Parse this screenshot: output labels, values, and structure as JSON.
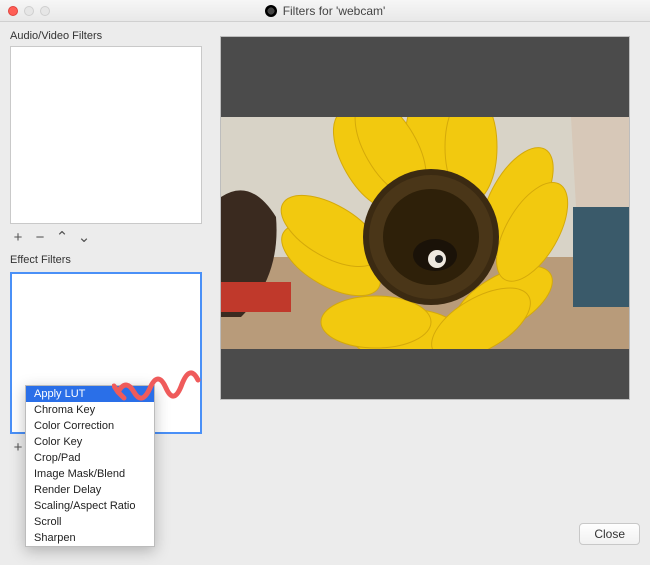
{
  "window": {
    "title": "Filters for 'webcam'"
  },
  "sections": {
    "audio_label": "Audio/Video Filters",
    "effect_label": "Effect Filters"
  },
  "toolbar": {
    "add": "+",
    "remove": "−",
    "up": "⌃",
    "down": "⌄"
  },
  "effect_menu": {
    "items": [
      "Apply LUT",
      "Chroma Key",
      "Color Correction",
      "Color Key",
      "Crop/Pad",
      "Image Mask/Blend",
      "Render Delay",
      "Scaling/Aspect Ratio",
      "Scroll",
      "Sharpen"
    ],
    "selected_index": 0
  },
  "footer": {
    "close_label": "Close"
  }
}
